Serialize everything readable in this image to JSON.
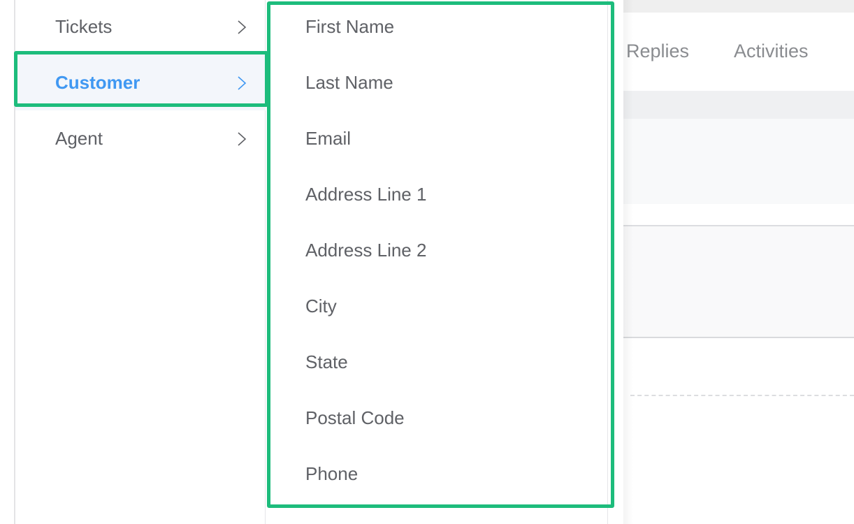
{
  "background_app": {
    "tabs": [
      {
        "label": "Replies"
      },
      {
        "label": "Activities"
      }
    ]
  },
  "cascader": {
    "level1": [
      {
        "label": "Tickets",
        "icon": "chevron-right-icon",
        "active": false
      },
      {
        "label": "Customer",
        "icon": "chevron-right-icon",
        "active": true
      },
      {
        "label": "Agent",
        "icon": "chevron-right-icon",
        "active": false
      }
    ],
    "level2": [
      {
        "label": "First Name"
      },
      {
        "label": "Last Name"
      },
      {
        "label": "Email"
      },
      {
        "label": "Address Line 1"
      },
      {
        "label": "Address Line 2"
      },
      {
        "label": "City"
      },
      {
        "label": "State"
      },
      {
        "label": "Postal Code"
      },
      {
        "label": "Phone"
      }
    ]
  },
  "colors": {
    "active_text": "#4098f2",
    "active_bg": "#f3f6fb",
    "text": "#5f6166",
    "highlight": "#1dbc7c"
  }
}
